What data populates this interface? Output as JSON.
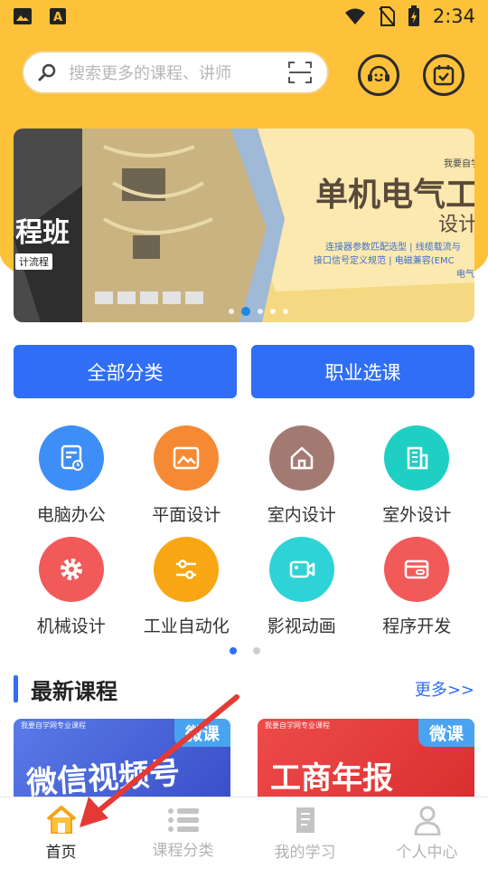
{
  "status_bar": {
    "time": "2:34"
  },
  "search": {
    "placeholder": "搜索更多的课程、讲师"
  },
  "banner": {
    "left_text": "程班",
    "left_sub": "计流程",
    "publisher": "我要自学",
    "headline": "单机电气工",
    "sub": "设计",
    "lines": [
      "连接器参数匹配选型 | 线缆载流与",
      "接口信号定义规范 | 电磁兼容(EMC",
      "电气装配"
    ]
  },
  "buttons": {
    "all_categories": "全部分类",
    "career_courses": "职业选课"
  },
  "categories": [
    {
      "label": "电脑办公",
      "color": "#3e8ef7",
      "icon": "document-clock-icon"
    },
    {
      "label": "平面设计",
      "color": "#f68a34",
      "icon": "image-icon"
    },
    {
      "label": "室内设计",
      "color": "#a37a72",
      "icon": "house-icon"
    },
    {
      "label": "室外设计",
      "color": "#1fcfc4",
      "icon": "building-icon"
    },
    {
      "label": "机械设计",
      "color": "#f25a5a",
      "icon": "gear-icon"
    },
    {
      "label": "工业自动化",
      "color": "#f8a613",
      "icon": "sliders-icon"
    },
    {
      "label": "影视动画",
      "color": "#2ed3d7",
      "icon": "video-camera-icon"
    },
    {
      "label": "程序开发",
      "color": "#f25a5a",
      "icon": "card-icon"
    }
  ],
  "latest": {
    "title": "最新课程",
    "more": "更多>>"
  },
  "courses": [
    {
      "tag": "微课",
      "title": "微信视频号",
      "small": "我要自学网专业课程"
    },
    {
      "tag": "微课",
      "title": "工商年报",
      "small": "我要自学网专业课程"
    }
  ],
  "tabs": [
    {
      "label": "首页",
      "icon": "home-icon",
      "active": true
    },
    {
      "label": "课程分类",
      "icon": "list-icon",
      "active": false
    },
    {
      "label": "我的学习",
      "icon": "notebook-icon",
      "active": false
    },
    {
      "label": "个人中心",
      "icon": "person-icon",
      "active": false
    }
  ],
  "colors": {
    "header": "#fdc13a",
    "primary": "#2f6ef5",
    "annotation_arrow": "#e53935"
  }
}
